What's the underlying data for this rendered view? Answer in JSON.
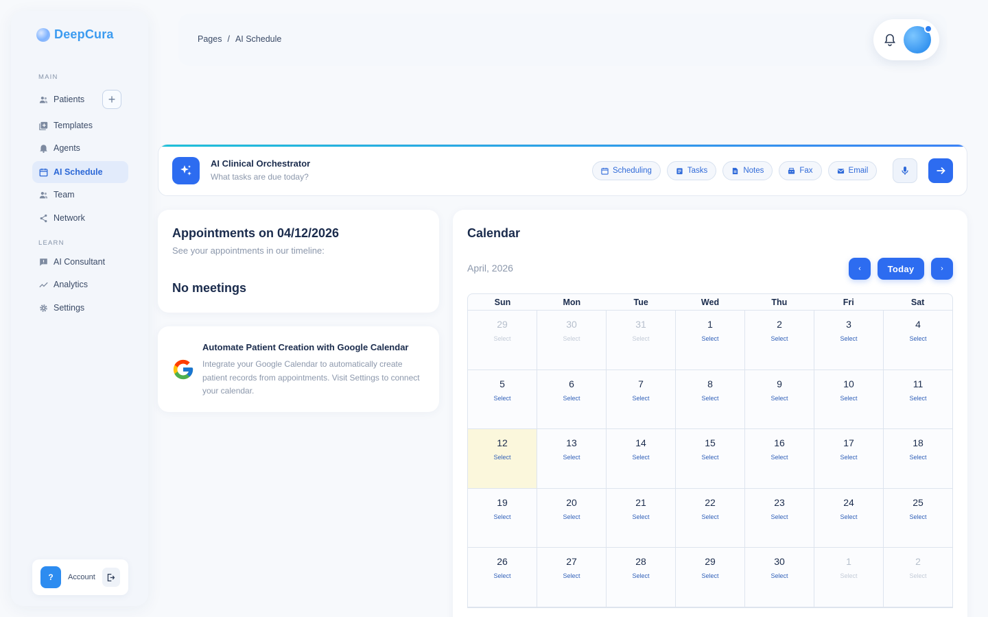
{
  "app": {
    "name": "DeepCura"
  },
  "sidebar": {
    "sections": [
      {
        "label": "MAIN"
      },
      {
        "label": "LEARN"
      }
    ],
    "items": [
      {
        "label": "Patients",
        "icon": "patients-icon"
      },
      {
        "label": "Templates",
        "icon": "templates-icon"
      },
      {
        "label": "Agents",
        "icon": "agents-icon"
      },
      {
        "label": "AI Schedule",
        "icon": "calendar-icon",
        "active": true
      },
      {
        "label": "Team",
        "icon": "team-icon"
      },
      {
        "label": "Network",
        "icon": "share-icon"
      },
      {
        "label": "AI Consultant",
        "icon": "chat-icon"
      },
      {
        "label": "Analytics",
        "icon": "analytics-icon"
      },
      {
        "label": "Settings",
        "icon": "gear-icon"
      }
    ],
    "account": {
      "help": "?",
      "label": "Account"
    }
  },
  "header": {
    "breadcrumb": [
      "Pages",
      "/",
      "AI Schedule"
    ]
  },
  "orchestrator": {
    "title": "AI Clinical Orchestrator",
    "placeholder": "What tasks are due today?",
    "chips": [
      "Scheduling",
      "Tasks",
      "Notes",
      "Fax",
      "Email"
    ]
  },
  "appointments": {
    "title": "Appointments on 04/12/2026",
    "subtitle": "See your appointments in our timeline:",
    "empty": "No meetings"
  },
  "google_calendar": {
    "title": "Automate Patient Creation with Google Calendar",
    "text": "Integrate your Google Calendar to automatically create patient records from appointments. Visit Settings to connect your calendar."
  },
  "calendar": {
    "title": "Calendar",
    "month": "April, 2026",
    "prev": "‹",
    "today": "Today",
    "next": "›",
    "weekdays": [
      "Sun",
      "Mon",
      "Tue",
      "Wed",
      "Thu",
      "Fri",
      "Sat"
    ],
    "select_label": "Select",
    "weeks": [
      [
        "29",
        "30",
        "31",
        "1",
        "2",
        "3",
        "4"
      ],
      [
        "5",
        "6",
        "7",
        "8",
        "9",
        "10",
        "11"
      ],
      [
        "12",
        "13",
        "14",
        "15",
        "16",
        "17",
        "18"
      ],
      [
        "19",
        "20",
        "21",
        "22",
        "23",
        "24",
        "25"
      ],
      [
        "26",
        "27",
        "28",
        "29",
        "30",
        "1",
        "2"
      ]
    ],
    "muted": [
      [
        0,
        0
      ],
      [
        0,
        1
      ],
      [
        0,
        2
      ],
      [
        4,
        5
      ],
      [
        4,
        6
      ]
    ],
    "today_cell": [
      2,
      0
    ],
    "today_color": "#fbf7dc",
    "accent": "#2d6cf0"
  }
}
